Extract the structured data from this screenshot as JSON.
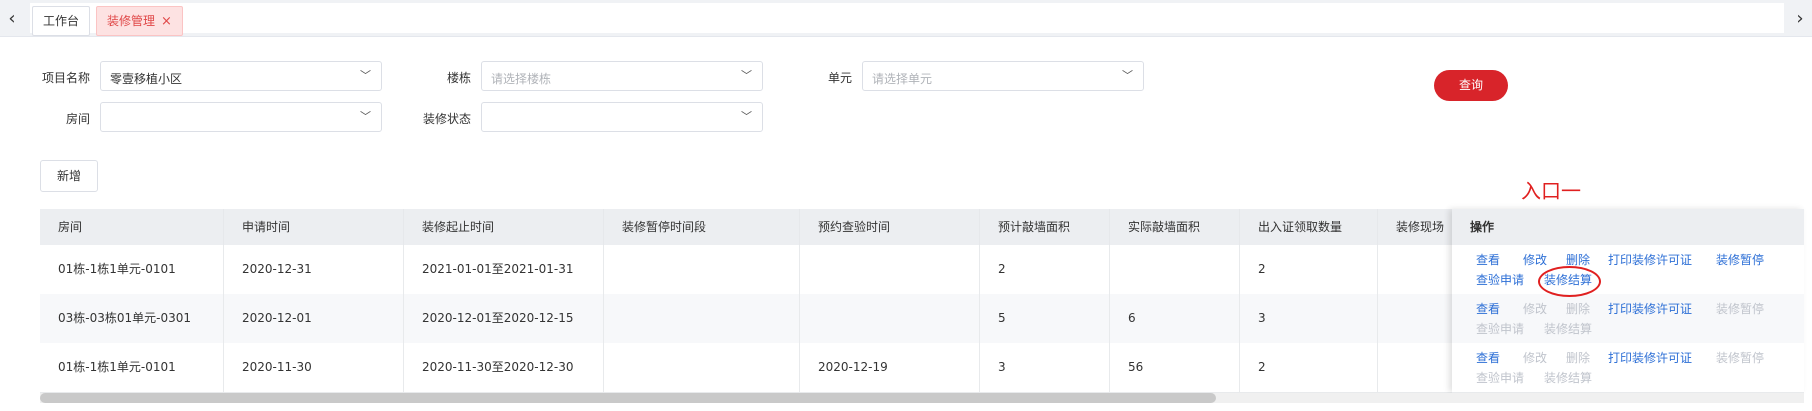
{
  "tabs": {
    "workbench": "工作台",
    "active": "装修管理",
    "close_icon": "×"
  },
  "filters": {
    "project_label": "项目名称",
    "project_value": "零壹移植小区",
    "building_label": "楼栋",
    "building_placeholder": "请选择楼栋",
    "unit_label": "单元",
    "unit_placeholder": "请选择单元",
    "room_label": "房间",
    "status_label": "装修状态",
    "query_button": "查询",
    "add_button": "新增"
  },
  "annotation": {
    "text": "入口一"
  },
  "table": {
    "columns": [
      "房间",
      "申请时间",
      "装修起止时间",
      "装修暂停时间段",
      "预约查验时间",
      "预计敲墙面积",
      "实际敲墙面积",
      "出入证领取数量",
      "装修现场"
    ],
    "ops_header": "操作",
    "rows": [
      {
        "room": "01栋-1栋1单元-0101",
        "apply": "2020-12-31",
        "period": "2021-01-01至2021-01-31",
        "pause": "",
        "inspect": "",
        "est_area": "2",
        "actual_area": "",
        "pass_count": "2",
        "site": ""
      },
      {
        "room": "03栋-03栋01单元-0301",
        "apply": "2020-12-01",
        "period": "2020-12-01至2020-12-15",
        "pause": "",
        "inspect": "",
        "est_area": "5",
        "actual_area": "6",
        "pass_count": "3",
        "site": ""
      },
      {
        "room": "01栋-1栋1单元-0101",
        "apply": "2020-11-30",
        "period": "2020-11-30至2020-12-30",
        "pause": "",
        "inspect": "2020-12-19",
        "est_area": "3",
        "actual_area": "56",
        "pass_count": "2",
        "site": ""
      }
    ],
    "ops": {
      "view": "查看",
      "edit": "修改",
      "delete": "删除",
      "print_permit": "打印装修许可证",
      "pause": "装修暂停",
      "inspect_apply": "查验申请",
      "settle": "装修结算"
    }
  },
  "colors": {
    "accent": "#d8242a",
    "link": "#2d6fd6",
    "disabled": "#c0c4cc",
    "annotation": "#e02020"
  }
}
